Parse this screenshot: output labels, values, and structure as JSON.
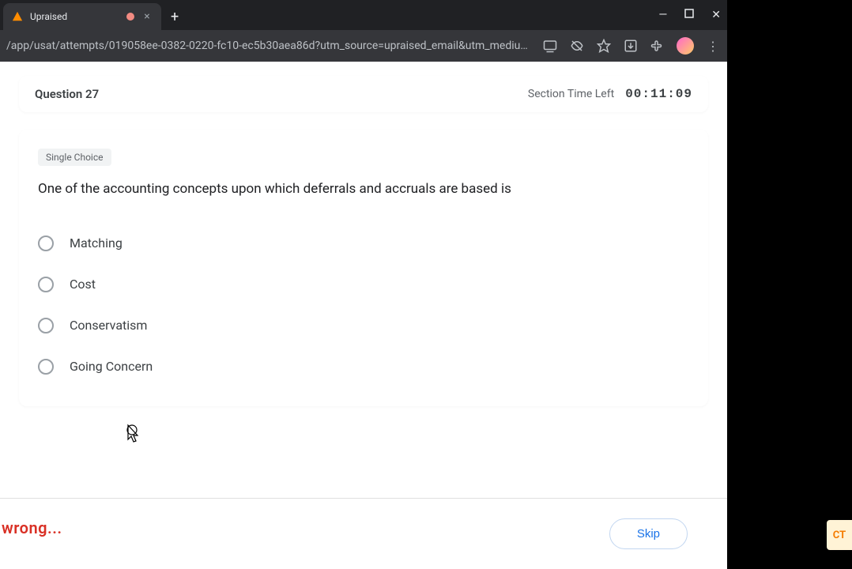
{
  "tab": {
    "title": "Upraised"
  },
  "url": "/app/usat/attempts/019058ee-0382-0220-fc10-ec5b30aea86d?utm_source=upraised_email&utm_medium=email&ut…",
  "header": {
    "question_label": "Question 27",
    "timer_label": "Section Time Left",
    "timer_value": "00:11:09"
  },
  "question": {
    "badge": "Single Choice",
    "text": "One of the accounting concepts upon which deferrals and accruals are based is",
    "options": [
      "Matching",
      "Cost",
      "Conservatism",
      "Going Concern"
    ]
  },
  "footer": {
    "skip_label": "Skip"
  },
  "overlay": {
    "wrong": "wrong..."
  },
  "sidebar_badge": "CT"
}
